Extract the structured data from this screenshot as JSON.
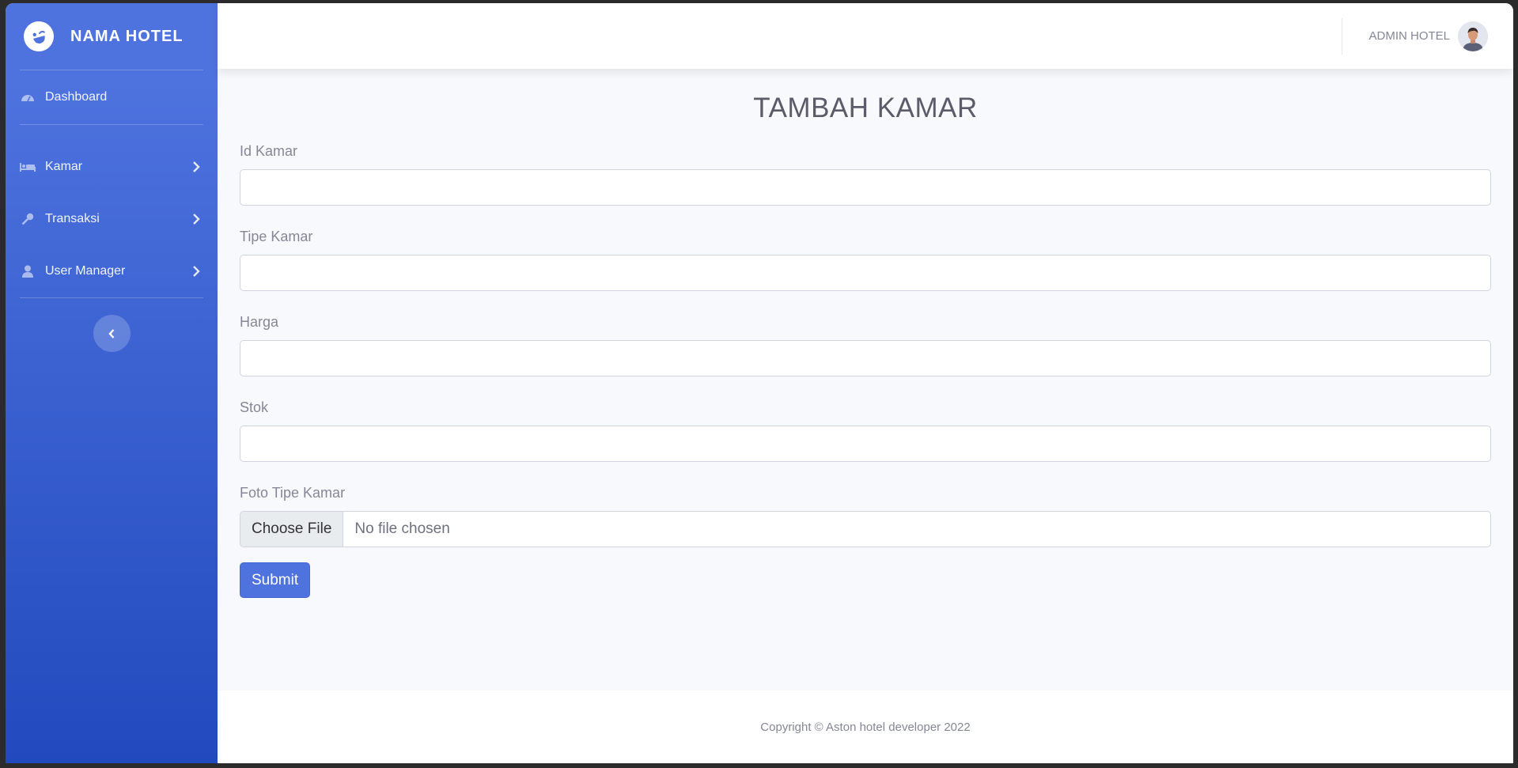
{
  "brand": {
    "name": "NAMA HOTEL",
    "icon": "laugh-wink-icon"
  },
  "sidebar": {
    "items": [
      {
        "label": "Dashboard",
        "icon": "tachometer-icon"
      },
      {
        "label": "Kamar",
        "icon": "bed-icon"
      },
      {
        "label": "Transaksi",
        "icon": "key-icon"
      },
      {
        "label": "User Manager",
        "icon": "user-icon"
      }
    ],
    "toggle_icon": "chevron-left-icon"
  },
  "topbar": {
    "user_name": "ADMIN HOTEL",
    "avatar_icon": "avatar-icon"
  },
  "page": {
    "title": "TAMBAH KAMAR"
  },
  "form": {
    "fields": [
      {
        "label": "Id Kamar",
        "value": ""
      },
      {
        "label": "Tipe Kamar",
        "value": ""
      },
      {
        "label": "Harga",
        "value": ""
      },
      {
        "label": "Stok",
        "value": ""
      }
    ],
    "file": {
      "label": "Foto Tipe Kamar",
      "button": "Choose File",
      "status": "No file chosen"
    },
    "submit_label": "Submit"
  },
  "footer": {
    "text": "Copyright © Aston hotel developer 2022"
  },
  "colors": {
    "primary": "#4e73df",
    "primary_dark": "#224abe",
    "text_muted": "#858796"
  }
}
